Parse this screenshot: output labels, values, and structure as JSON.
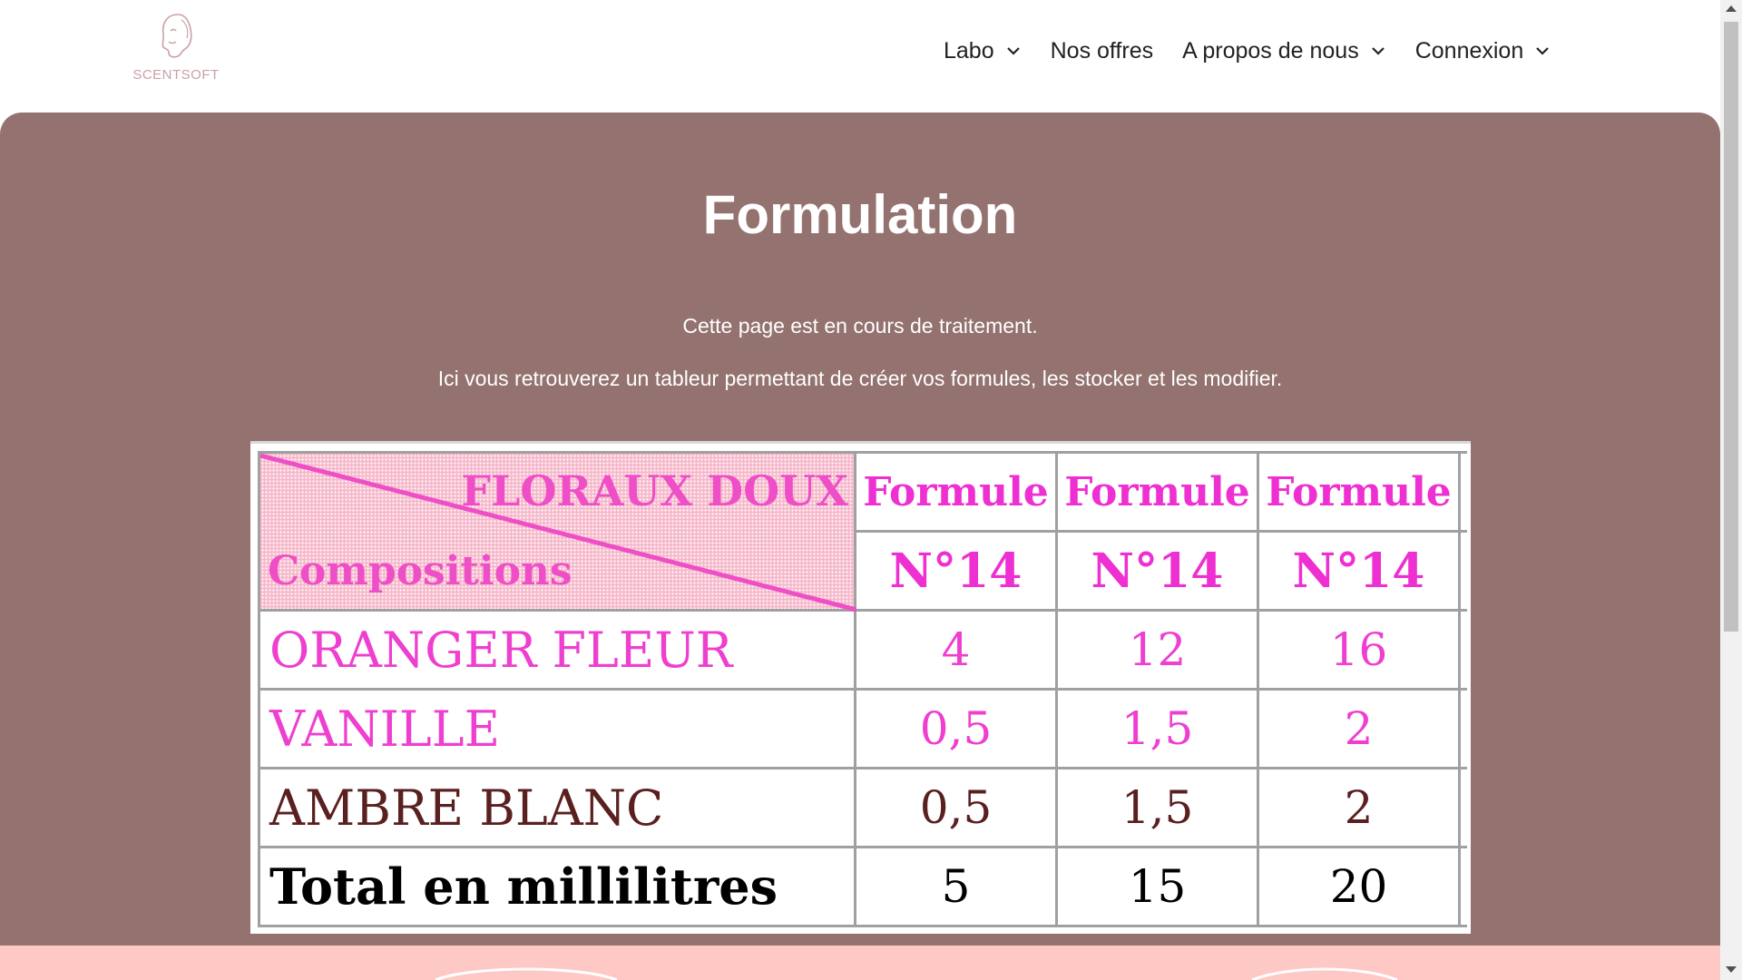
{
  "header": {
    "logo_text": "SCENTSOFT",
    "nav": [
      {
        "label": "Labo",
        "has_dropdown": true
      },
      {
        "label": "Nos offres",
        "has_dropdown": false
      },
      {
        "label": "A propos de nous",
        "has_dropdown": true
      },
      {
        "label": "Connexion",
        "has_dropdown": true
      }
    ]
  },
  "main": {
    "title": "Formulation",
    "paragraph1": "Cette page est en cours de traitement.",
    "paragraph2": "Ici vous retrouverez un tableur permettant de créer vos formules, les stocker et les modifier."
  },
  "sheet": {
    "corner_top": "FLORAUX DOUX",
    "corner_bottom": "Compositions",
    "headers_line1": [
      "Formule",
      "Formule",
      "Formule"
    ],
    "headers_line2": [
      "N°14",
      "N°14",
      "N°14"
    ],
    "rows": [
      {
        "label": "ORANGER FLEUR",
        "values": [
          "4",
          "12",
          "16"
        ]
      },
      {
        "label": "VANILLE",
        "values": [
          "0,5",
          "1,5",
          "2"
        ]
      },
      {
        "label": "AMBRE BLANC",
        "values": [
          "0,5",
          "1,5",
          "2"
        ]
      },
      {
        "label": "Total en millilitres",
        "values": [
          "5",
          "15",
          "20"
        ]
      }
    ]
  },
  "colors": {
    "panel": "#93726f",
    "footer": "#fec8c4",
    "pink_text": "#ee3fd0",
    "brown_text": "#5a1f1f"
  }
}
